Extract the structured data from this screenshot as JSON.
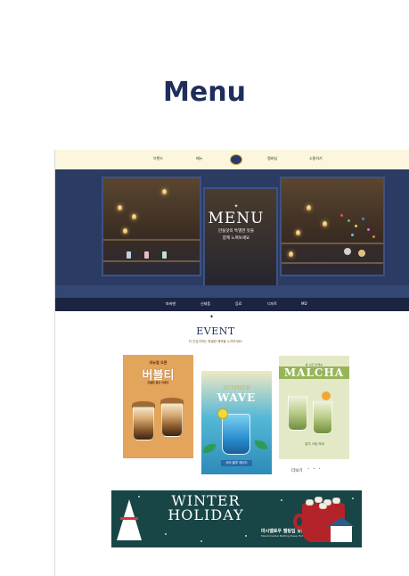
{
  "page": {
    "heading": "Menu"
  },
  "mockup": {
    "topnav": {
      "items": [
        "브랜드",
        "메뉴",
        "",
        "멤버십",
        "소통하기"
      ]
    },
    "hero": {
      "title": "MENU",
      "subtitle_line1": "만들맛의 특별한 맛을",
      "subtitle_line2": "함께 느껴보세요"
    },
    "subnav": {
      "items": [
        "파바맨",
        "신제품",
        "음료",
        "디저트",
        "MD"
      ]
    },
    "event": {
      "title": "EVENT",
      "subtitle": "더 진심이하는 특별한 혜택을 누려보세요!"
    },
    "cards": [
      {
        "small": "리뉴얼 오픈",
        "big": "버블티",
        "desc": "특별한 할인 이벤트"
      },
      {
        "small": "SUMMER",
        "big": "WAVE",
        "label": "서머 블루 에이드"
      },
      {
        "small": "봄 시즌 새 메뉴",
        "big": "MALCHA",
        "label": "말차 크림 라떼"
      }
    ],
    "more": {
      "label": "더보기",
      "dots": "• • •"
    },
    "banner": {
      "title_line1": "WINTER",
      "title_line2": "HOLIDAY",
      "ko": "마시멜로우 멜팅딥 핫초코",
      "en": "Marshmallow Melting Deep Hot Chocolate"
    }
  },
  "colors": {
    "heading": "#1f2d5c",
    "topnav_bg": "#fbf6dd",
    "subnav_bg": "#1b2440",
    "banner_bg": "#184545"
  }
}
